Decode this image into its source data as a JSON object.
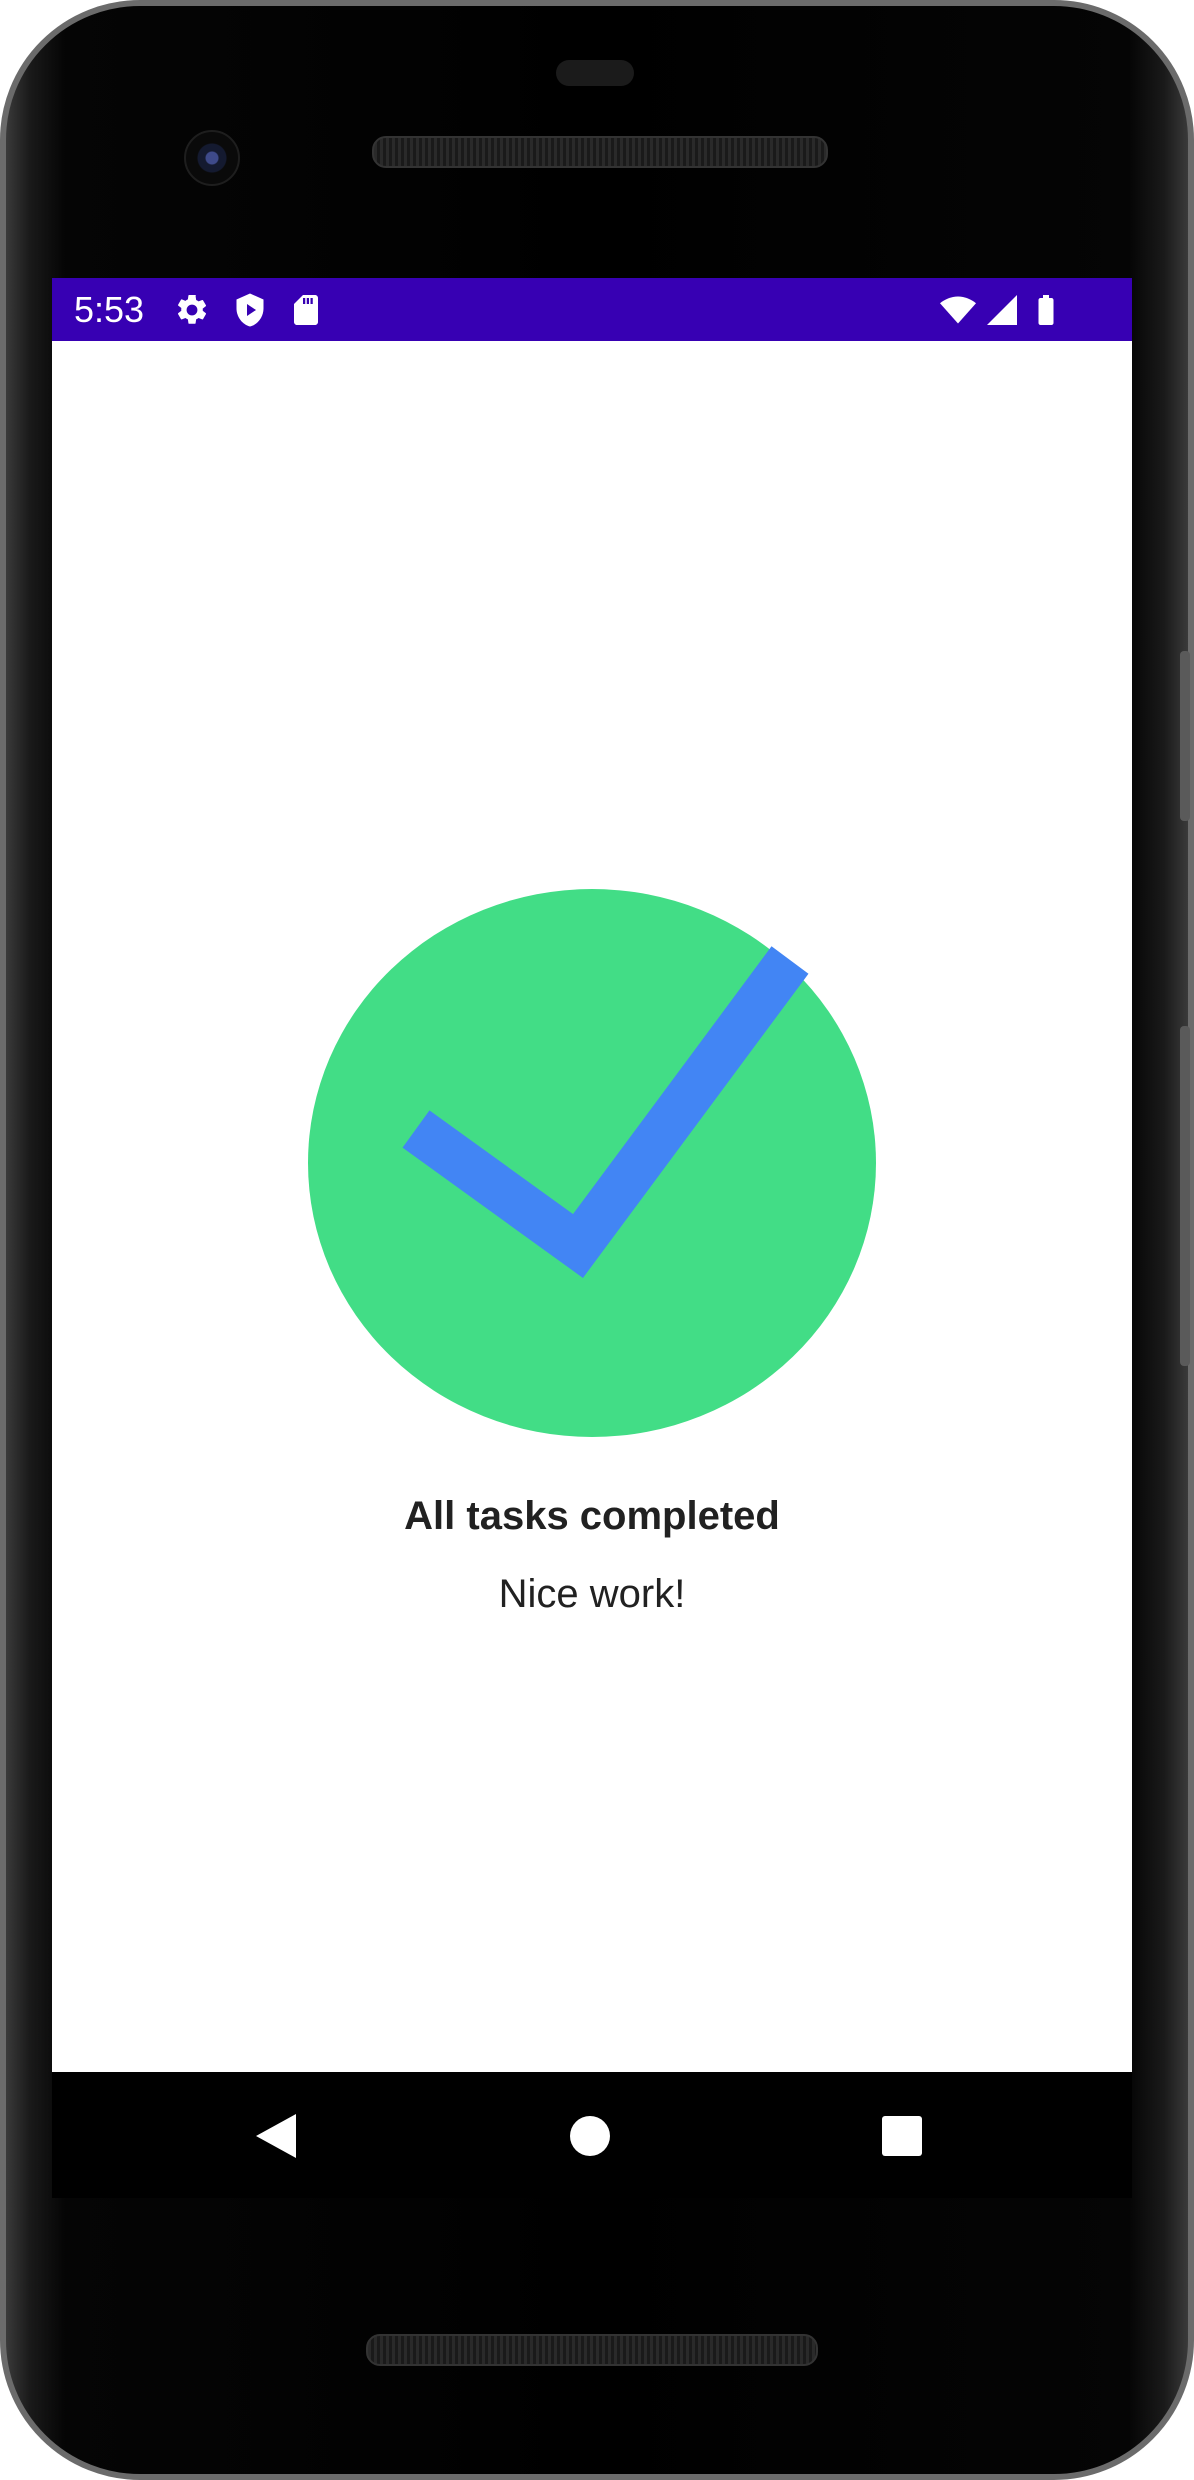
{
  "status_bar": {
    "time": "5:53",
    "background_color": "#3700b3",
    "left_icons": [
      "gear-icon",
      "shield-play-icon",
      "sd-card-icon"
    ],
    "right_icons": [
      "wifi-icon",
      "cell-signal-icon",
      "battery-icon"
    ]
  },
  "main": {
    "status_icon": "check-circle-icon",
    "circle_color": "#42dd86",
    "check_color": "#4285f4",
    "title": "All tasks completed",
    "subtitle": "Nice work!"
  },
  "nav_bar": {
    "buttons": [
      "back-icon",
      "home-icon",
      "recents-icon"
    ]
  }
}
